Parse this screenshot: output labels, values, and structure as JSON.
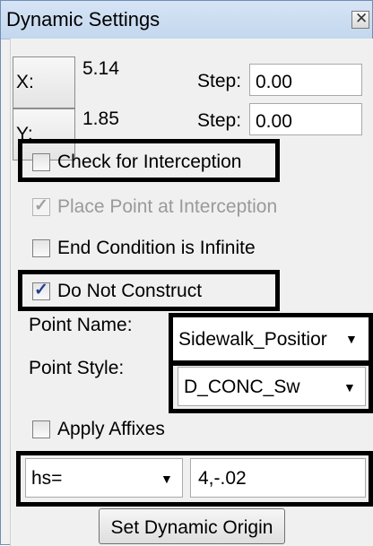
{
  "window": {
    "title": "Dynamic Settings",
    "close_glyph": "✕"
  },
  "coords": {
    "x": {
      "button_label": "X:",
      "value": "5.14",
      "step_label": "Step:",
      "step_value": "0.00"
    },
    "y": {
      "button_label": "Y:",
      "value": "1.85",
      "step_label": "Step:",
      "step_value": "0.00"
    }
  },
  "checkboxes": {
    "check_interception": {
      "label": "Check for Interception",
      "checked": false
    },
    "place_point": {
      "label": "Place Point at Interception",
      "checked": true,
      "disabled": true
    },
    "end_condition": {
      "label": "End Condition is Infinite",
      "checked": false
    },
    "do_not_construct": {
      "label": "Do Not Construct",
      "checked": true
    },
    "apply_affixes": {
      "label": "Apply Affixes",
      "checked": false
    }
  },
  "point_name": {
    "label": "Point Name:",
    "value": "Sidewalk_Positior"
  },
  "point_style": {
    "label": "Point Style:",
    "value": "D_CONC_Sw"
  },
  "affix": {
    "select_value": "hs=",
    "input_value": "4,-.02"
  },
  "set_origin_button": "Set Dynamic Origin",
  "check_glyph": "✓",
  "dropdown_glyph": "▼",
  "colors": {
    "title_bar": "#c9dcf1",
    "panel": "#f0f0f0",
    "check": "#1f3f93",
    "highlight_border": "#000000"
  }
}
